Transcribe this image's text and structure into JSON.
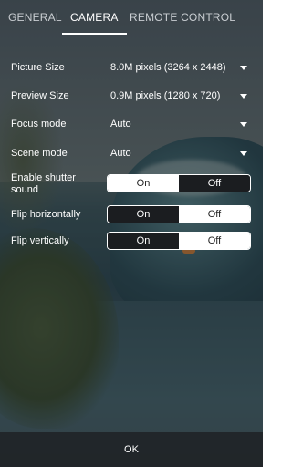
{
  "tabs": [
    {
      "label": "GENERAL"
    },
    {
      "label": "CAMERA"
    },
    {
      "label": "REMOTE CONTROL"
    }
  ],
  "active_tab": "CAMERA",
  "settings": {
    "picture_size": {
      "label": "Picture Size",
      "value": "8.0M pixels (3264  x 2448)"
    },
    "preview_size": {
      "label": "Preview Size",
      "value": "0.9M pixels (1280 x 720)"
    },
    "focus_mode": {
      "label": "Focus mode",
      "value": "Auto"
    },
    "scene_mode": {
      "label": "Scene mode",
      "value": "Auto"
    }
  },
  "toggles": {
    "shutter_sound": {
      "label": "Enable shutter sound",
      "on_label": "On",
      "off_label": "Off",
      "selected": "On"
    },
    "flip_horizontally": {
      "label": "Flip horizontally",
      "on_label": "On",
      "off_label": "Off",
      "selected": "Off"
    },
    "flip_vertically": {
      "label": "Flip vertically",
      "on_label": "On",
      "off_label": "Off",
      "selected": "Off"
    }
  },
  "footer": {
    "ok_label": "OK"
  }
}
